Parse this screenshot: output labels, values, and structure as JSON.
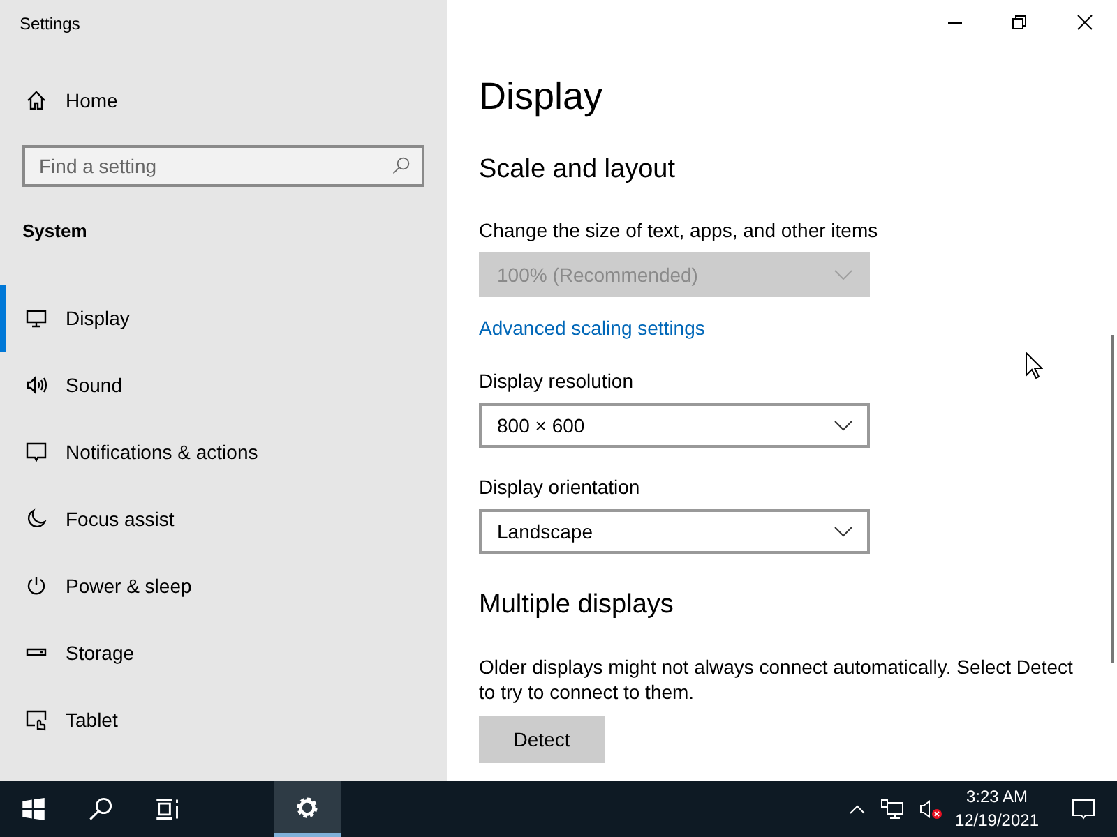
{
  "window": {
    "title": "Settings"
  },
  "sidebar": {
    "home": {
      "label": "Home"
    },
    "search": {
      "placeholder": "Find a setting"
    },
    "section": "System",
    "items": [
      {
        "label": "Display",
        "selected": true
      },
      {
        "label": "Sound",
        "selected": false
      },
      {
        "label": "Notifications & actions",
        "selected": false
      },
      {
        "label": "Focus assist",
        "selected": false
      },
      {
        "label": "Power & sleep",
        "selected": false
      },
      {
        "label": "Storage",
        "selected": false
      },
      {
        "label": "Tablet",
        "selected": false
      }
    ]
  },
  "main": {
    "title": "Display",
    "sections": [
      {
        "heading": "Scale and layout",
        "controls": [
          {
            "kind": "dropdown",
            "label": "Change the size of text, apps, and other items",
            "value": "100% (Recommended)",
            "disabled": true
          },
          {
            "kind": "link",
            "text": "Advanced scaling settings"
          },
          {
            "kind": "dropdown",
            "label": "Display resolution",
            "value": "800 × 600",
            "disabled": false
          },
          {
            "kind": "dropdown",
            "label": "Display orientation",
            "value": "Landscape",
            "disabled": false
          }
        ]
      },
      {
        "heading": "Multiple displays",
        "controls": [
          {
            "kind": "text",
            "text": "Older displays might not always connect automatically. Select Detect to try to connect to them."
          },
          {
            "kind": "button",
            "text": "Detect"
          }
        ]
      }
    ]
  },
  "taskbar": {
    "buttons": [
      {
        "kind": "start",
        "selected": false
      },
      {
        "kind": "search",
        "selected": false
      },
      {
        "kind": "taskview",
        "selected": false
      },
      {
        "kind": "settings",
        "selected": true
      }
    ],
    "clock": {
      "time": "3:23 AM",
      "date": "12/19/2021"
    }
  }
}
